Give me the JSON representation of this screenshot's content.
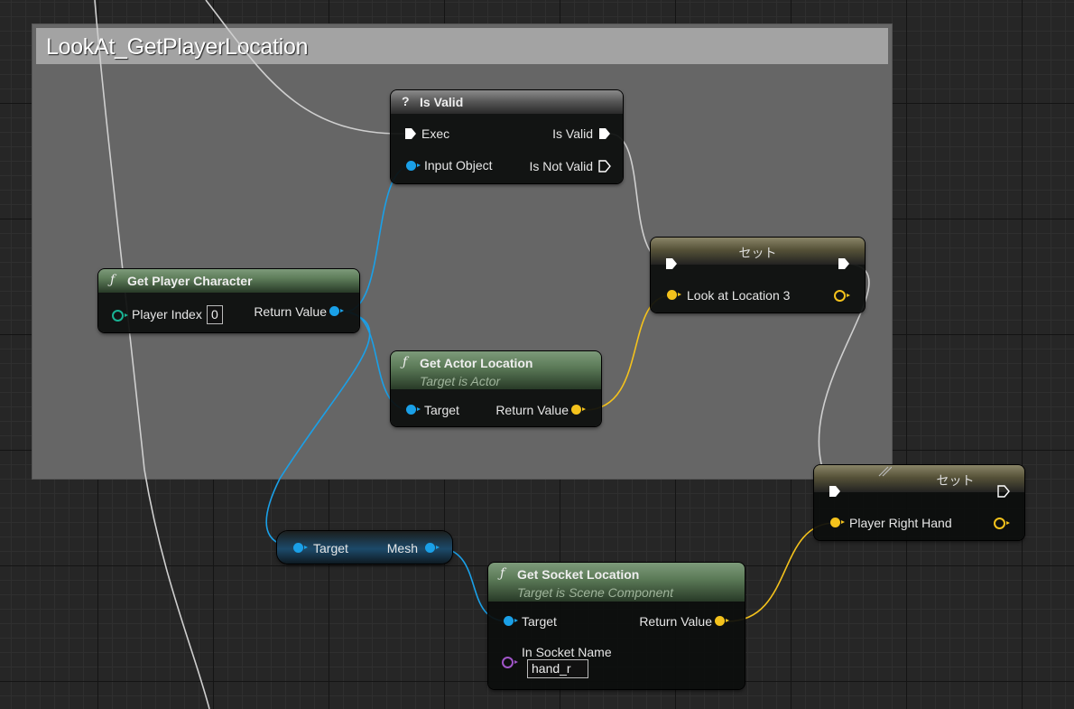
{
  "comment": {
    "title": "LookAt_GetPlayerLocation"
  },
  "nodes": {
    "is_valid": {
      "title": "Is Valid",
      "exec_in": "Exec",
      "input_object": "Input Object",
      "is_valid_out": "Is Valid",
      "is_not_valid_out": "Is Not Valid"
    },
    "get_player_character": {
      "title": "Get Player Character",
      "player_index_label": "Player Index",
      "player_index_value": "0",
      "return_value": "Return Value"
    },
    "get_actor_location": {
      "title": "Get Actor Location",
      "subtitle": "Target is Actor",
      "target": "Target",
      "return_value": "Return Value"
    },
    "set_look": {
      "title": "セット",
      "var_label": "Look at Location 3"
    },
    "set_hand": {
      "title": "セット",
      "var_label": "Player Right Hand"
    },
    "mesh_getter": {
      "target": "Target",
      "mesh": "Mesh"
    },
    "get_socket_location": {
      "title": "Get Socket Location",
      "subtitle": "Target is Scene Component",
      "target": "Target",
      "return_value": "Return Value",
      "in_socket_name": "In Socket Name",
      "in_socket_value": "hand_r"
    }
  },
  "icons": {
    "function": "ƒ",
    "question": "?"
  },
  "colors": {
    "object_pin": "#1aa0e8",
    "vector_pin": "#f4c21c",
    "int_pin": "#19b394",
    "name_pin": "#a055c8",
    "exec_wire": "#d8d8d8"
  }
}
